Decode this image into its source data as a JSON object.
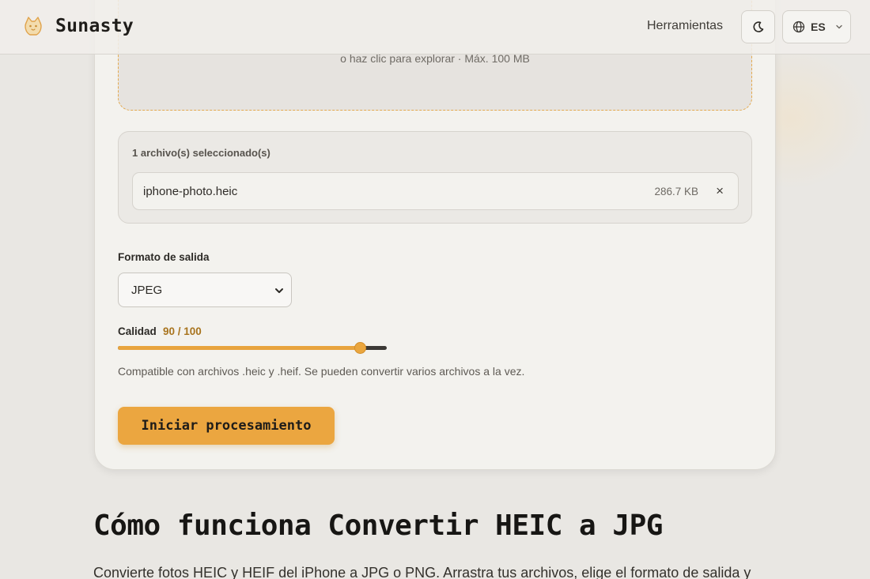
{
  "header": {
    "brand": "Sunasty",
    "logo_icon": "cat-logo-icon",
    "nav_tools": "Herramientas",
    "theme_icon": "moon-icon",
    "lang_icon": "globe-icon",
    "lang_label": "ES"
  },
  "dropzone": {
    "hint": "o haz clic para explorar · Máx. 100 MB"
  },
  "files": {
    "count_label": "1 archivo(s) seleccionado(s)",
    "items": [
      {
        "name": "iphone-photo.heic",
        "size": "286.7 KB",
        "remove": "×"
      }
    ]
  },
  "output": {
    "label": "Formato de salida",
    "selected": "JPEG"
  },
  "quality": {
    "label": "Calidad",
    "value_text": "90 / 100",
    "value": 90,
    "max": 100
  },
  "hint": "Compatible con archivos .heic y .heif. Se pueden convertir varios archivos a la vez.",
  "cta": "Iniciar procesamiento",
  "section": {
    "title": "Cómo funciona Convertir HEIC a JPG",
    "intro": "Convierte fotos HEIC y HEIF del iPhone a JPG o PNG. Arrastra tus archivos, elige el formato de salida y"
  },
  "colors": {
    "accent": "#eba640",
    "accent_text": "#a8741e",
    "background": "#e9e7e3",
    "card": "#f3f2ee"
  }
}
